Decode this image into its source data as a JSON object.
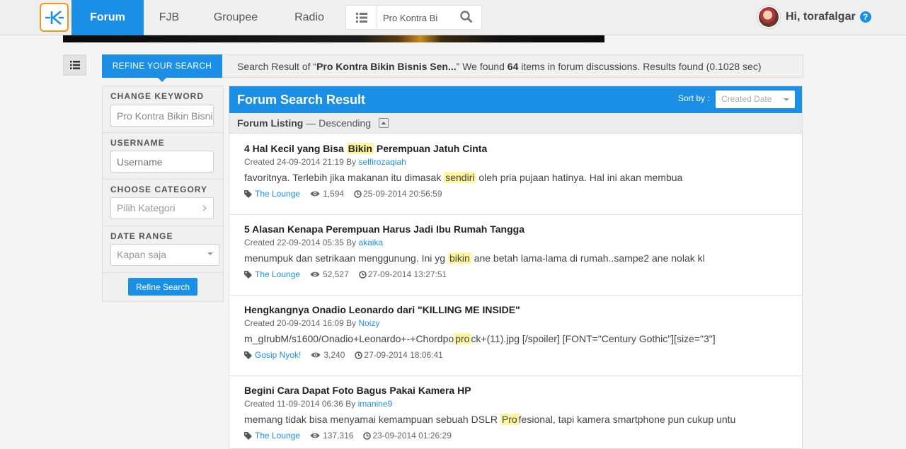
{
  "nav": {
    "tabs": [
      {
        "label": "Forum",
        "active": true
      },
      {
        "label": "FJB",
        "active": false
      },
      {
        "label": "Groupee",
        "active": false
      },
      {
        "label": "Radio",
        "active": false
      }
    ],
    "search_value": "Pro Kontra Bi",
    "user_greeting": "Hi, torafalgar",
    "help_icon": "?"
  },
  "colors": {
    "accent": "#1b8fe6",
    "logo_border": "#f7941d",
    "highlight": "#fff59d"
  },
  "refine": {
    "tab_label": "REFINE YOUR SEARCH",
    "summary_prefix": "Search Result of “",
    "summary_query": "Pro Kontra Bikin Bisnis Sen...",
    "summary_mid": "” We found ",
    "summary_count": "64",
    "summary_suffix": " items in forum discussions. Results found (0.1028 sec)"
  },
  "sidebar": {
    "keyword_label": "CHANGE KEYWORD",
    "keyword_value": "Pro Kontra Bikin Bisnis",
    "username_label": "USERNAME",
    "username_placeholder": "Username",
    "category_label": "CHOOSE CATEGORY",
    "category_value": "Pilih Kategori",
    "date_label": "DATE RANGE",
    "date_value": "Kapan saja",
    "refine_button": "Refine Search"
  },
  "results": {
    "title": "Forum Search Result",
    "sort_label": "Sort by :",
    "sort_value": "Created Date",
    "listing_label": "Forum Listing",
    "listing_order": " — Descending",
    "items": [
      {
        "title_pre": "4 Hal Kecil yang Bisa ",
        "title_hl": "Bikin",
        "title_post": " Perempuan Jatuh Cinta",
        "created": "Created 24-09-2014 21:19 By ",
        "author": "selfirozaqiah",
        "snippet_pre": "favoritnya. Terlebih jika makanan itu dimasak ",
        "snippet_hl": "sendiri",
        "snippet_post": " oleh pria pujaan hatinya. Hal ini akan membua",
        "category": "The Lounge",
        "views": "1,594",
        "last_date": "25-09-2014 20:56:59"
      },
      {
        "title_pre": "5 Alasan Kenapa Perempuan Harus Jadi Ibu Rumah Tangga",
        "title_hl": "",
        "title_post": "",
        "created": "Created 22-09-2014 05:35 By ",
        "author": "akaika",
        "snippet_pre": "menumpuk dan setrikaan menggunung. Ini yg ",
        "snippet_hl": "bikin",
        "snippet_post": " ane betah lama-lama di rumah..sampe2 ane nolak kl",
        "category": "The Lounge",
        "views": "52,527",
        "last_date": "27-09-2014 13:27:51"
      },
      {
        "title_pre": "Hengkangnya Onadio Leonardo dari \"KILLING ME INSIDE\"",
        "title_hl": "",
        "title_post": "",
        "created": "Created 20-09-2014 16:09 By ",
        "author": "Noizy",
        "snippet_pre": "m_gIrubM/s1600/Onadio+Leonardo+-+Chordpo",
        "snippet_hl": "pro",
        "snippet_post": "ck+(11).jpg [/spoiler] [FONT=\"Century Gothic\"][size=\"3\"]",
        "category": "Gosip Nyok!",
        "views": "3,240",
        "last_date": "27-09-2014 18:06:41"
      },
      {
        "title_pre": "Begini Cara Dapat Foto Bagus Pakai Kamera HP",
        "title_hl": "",
        "title_post": "",
        "created": "Created 11-09-2014 06:36 By ",
        "author": "imanine9",
        "snippet_pre": "memang tidak bisa menyamai kemampuan sebuah DSLR ",
        "snippet_hl": "Pro",
        "snippet_post": "fesional, tapi kamera smartphone pun cukup untu",
        "category": "The Lounge",
        "views": "137,316",
        "last_date": "23-09-2014 01:26:29"
      }
    ]
  }
}
